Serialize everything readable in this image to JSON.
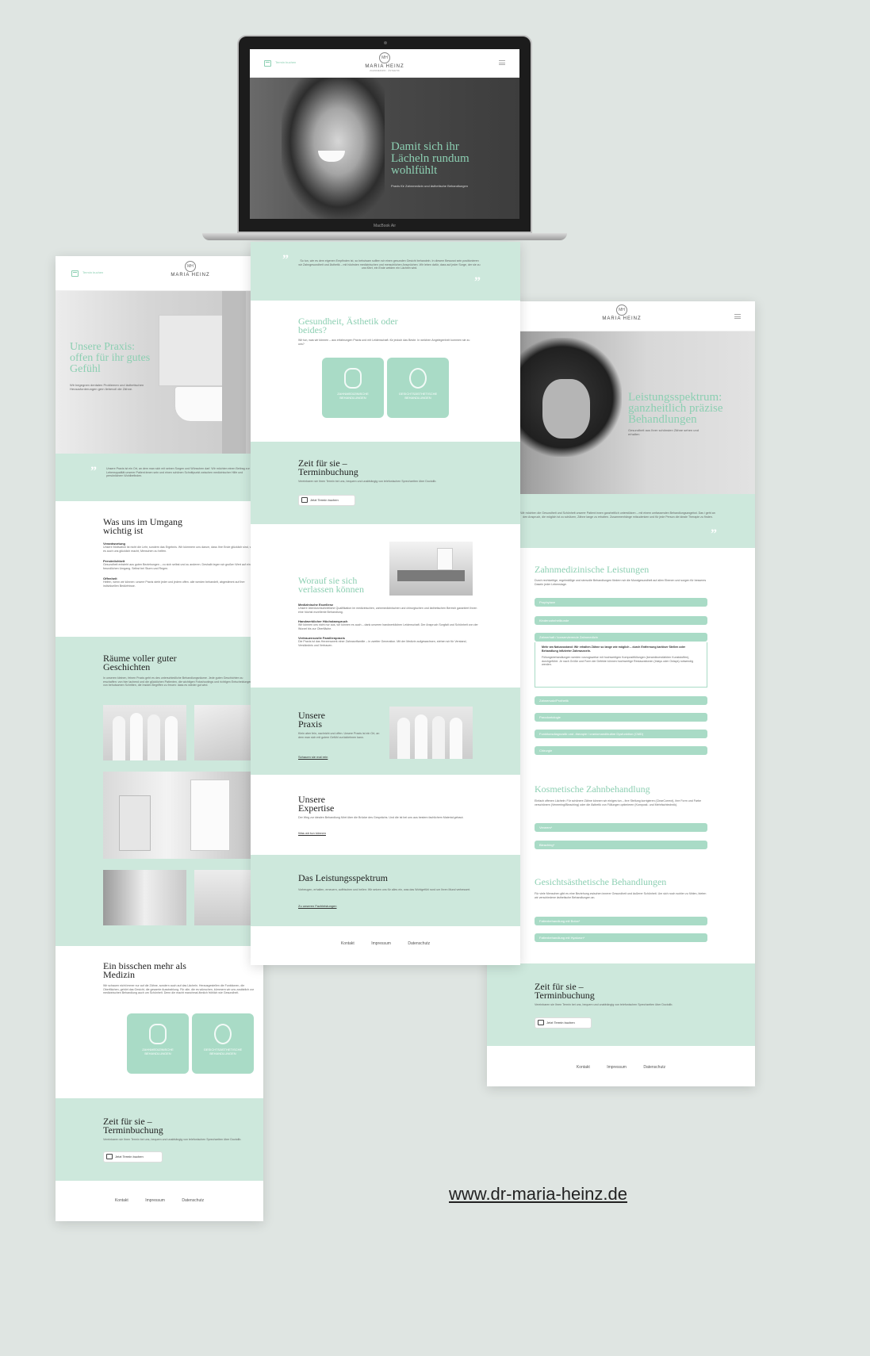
{
  "brand": {
    "name": "MARIA HEINZ",
    "monogram": "MH",
    "tagline": "ZAHNMEDIZIN · ÄSTHETIK",
    "booking_link": "Termin buchen",
    "accent_color": "#8ccfb2",
    "mint_color": "#cde8dc"
  },
  "laptop": {
    "label": "MacBook Air",
    "hero_title": "Damit sich ihr Lächeln rundum wohlfühlt",
    "hero_sub": "Praxis für Zahnmedizin und ästhetische Behandlungen"
  },
  "center_page": {
    "quote": "So tun, wie es dem eigenen Empfinden ist, so behutsam sollten wir einen gesunden Gesicht behandeln. In diesem Bewusst sein positionieren wir Zahngesundheit und Ästhetik – mit höchsten medizinischen und menschlichen Ansprüchen. Wir leben dafür, dass auf jeder Sorge, der sie zu uns führt, ein Ende weiden ein Lächeln wird.",
    "s1_title": "Gesundheit, Ästhetik oder beides?",
    "s1_text": "Wir tun, was wir können – aus erfahrungen Praxis und mit Leidenschaft. für jedoch das Beste. In welchen Angelegenheit kommen sie zu uns?",
    "tile1": "ZAHNMEDIZINISCHE BEHANDLUNGEN",
    "tile2": "GESICHTSÄSTHETISCHE BEHANDLUNGEN",
    "booking_title": "Zeit für sie – Terminbuchung",
    "booking_text": "Vereinbaren sie Ihren Termin bei uns, bequem und unabhängig von telefonischen Sprechzeiten über Doctolib.",
    "booking_btn": "Jetzt Termin buchen",
    "rely_title": "Worauf sie sich verlassen können",
    "rely_items": [
      {
        "h": "Medizinische Exzellenz",
        "t": "Unsere überdurchschnittliche Qualifikation im medizinischen, zahnmedizinischen und chirurgischen und ästhetischen Bereich garantiert Ihnen eine höchst exzellente Behandlung."
      },
      {
        "h": "Handwerklicher Höchstanspruch",
        "t": "Wir können uns nicht nur aus, wir können es auch – dank unseren handwerklichen Leidenschaft. Der Anspruch Sorgfalt und Schönheit von der Wurzel bis zur Oberfläche."
      },
      {
        "h": "Vertrauensvolle Familienpraxis",
        "t": "Die Praxis ist das Herzenswerk einer Zahnarztfamilie – in zweiter Generation. Mit der Medizin aufgewachsen, stehen wir für Verstand, Verständnis und Vertrauen."
      }
    ],
    "praxis_title": "Unsere Praxis",
    "praxis_text": "Klein aber fein, nachricht und offen. Unsere Praxis ist ein Ort, an dem man sich mit gutem Gefühl zurücklehnen kann.",
    "praxis_link": "Schauen sie mal rein",
    "expertise_title": "Unsere Expertise",
    "expertise_text": "Der Weg zur idealen Behandlung führt über die Brücke des Gesprächs. Und die ist bei uns aus bestem fachlichem Material gebaut.",
    "expertise_link": "Was wir tun können",
    "leist_title": "Das Leistungsspektrum",
    "leist_text": "Vorbeugen, erhalten, erneuern, auffrischen und heilen: Wir setzen uns für alles ein, was das Wohlgefühl rund um Ihren Mund verbessert.",
    "leist_link": "Zu unseren Fachleistungen"
  },
  "left_page": {
    "hero_title": "Unsere Praxis: offen für ihr gutes Gefühl",
    "hero_sub": "Wir begegnen dentalen Problemen und ästhetischen Herausforderungen gern liebevoll die Zähne.",
    "quote": "Unsere Praxis ist ein Ort, an dem man sich mit seinen Sorgen und Wünschen darf. Wir möchten einen Beitrag zur Lebensqualität unserer Patient:innen sein und einen schönen Schnittpunkt zwischen medizinischer Hilfe und persönlichem Wohlbefinden.",
    "values_title": "Was uns im Umgang wichtig ist",
    "values": [
      {
        "h": "Verantwortung",
        "t": "Unsere Motivation ist nicht die Lehr, sondern das Ergebnis. Wir kümmern uns darum, dass Ihre Ende glücklich sind, weil es auch uns glücklich macht, Menschen zu helfen."
      },
      {
        "h": "Persönlichkeit",
        "t": "Gesundheit entsteht aus guten Beziehungen – zu sich selbst und zu anderen. Deshalb legen wir großen Wert auf einen freundlichen Umgang. Selbst bei Sturm und Regen."
      },
      {
        "h": "Offenheit",
        "t": "Helfen, wenn wir können: unsere Praxis steht jeder und jedem offen. alle werden behandelt, abgestimmt auf ihre individuellen Bedürfnisse."
      }
    ],
    "rooms_title": "Räume voller guter Geschichten",
    "rooms_text": "In unseren kleinen, feinen Praxis geht es des unterschiedliche Behandlungsräume. Jede guten Geschichten zu erschaffen: von hier lachend und die glücklichen Patienten, die wichtigen Fotoshootings und richtigen Entscheidungen, von behutsamen Schritten, die Insider-Begriffen zu freuen: dass es wieder gut wird.",
    "more_title": "Ein bisschen mehr als Medizin",
    "more_text": "Wir schauen nicht immer nur auf die Zähne, sondern auch auf das Lächeln. Herausgestellen die Funktionen, die Oberflächen, gehört das Gesicht, die gesamte Ausstrahlung. Für alle, die es wünschen, kümmern wir uns zusätzlich zur medizinischen Behandlung auch um Schönheit. Denn die macht manchmal ähnlich fröhlich wie Gesundheit.",
    "tile1": "ZAHNMEDIZINISCHE BEHANDLUNGEN",
    "tile2": "GESICHTSÄSTHETISCHE BEHANDLUNGEN",
    "booking_title": "Zeit für sie – Terminbuchung",
    "booking_text": "Vereinbaren sie Ihren Termin bei uns, bequem und unabhängig von telefonischen Sprechzeiten über Doctolib.",
    "booking_btn": "Jetzt Termin buchen"
  },
  "right_page": {
    "hero_title": "Leistungsspektrum: ganzheitlich präzise Behandlungen",
    "hero_sub": "Gesundheit aus Ihrer schönsten Zähne sehen und erhalten",
    "quote": "Wir möchten die Gesundheit und Schönheit unserer Patient:innen ganzheitlich unterstützen – mit einem umfassenden Behandlungsangebot. Das i geht an den Anspruch, die möglich ist zu schützen, Zähne lange zu erhalten. Zusammenhänge mitzudenken und für jede Person die ideale Therapie zu finden.",
    "zm_title": "Zahnmedizinische Leistungen",
    "zm_text": "Durch rechtzeitige, regelmäßige und sinnvolle Behandlungen fördern wir die Mundgesundheit auf allen Ebenen und sorgen für besseres Dasein jeder Lebenslage.",
    "zm_items": [
      "Prophylaxe",
      "Kinderzahnheilkunde",
      "Zahnerhalt / konservierende Zahnmedizin",
      "Zahnersatz/Prothetik",
      "Parodontologie",
      "Funktionsdiagnostik und -therapie / craniomandibuläre Dysfunktion (CMD)",
      "Chirurgie"
    ],
    "zm_open_head": "Mehr am Naturzustand: Wir erhalten Zähne so lange wie möglich – durch Entfernung kariöser Stellen oder Behandlung infizierter Zahnwurzeln.",
    "zm_open_text": "Füllungsbehandlungen werden vorzugsweise mit hochwertigen Kompositfüllungen (keramikverstärkten Kunststoffen), durchgeführt. Je nach Größe und Form der Defekte können hochwertige Restaurationen (Inlays oder Onlays) notwendig werden.",
    "kz_title": "Kosmetische Zahnbehandlung",
    "kz_text": "Einfach offenen Lächeln: Für schönere Zähne können wir einiges tun – ihre Stellung korrigieren (ClearCorrect), ihre Form und Farbe verschönern (Veneering/Bleaching) oder die Ästhetik von Füllungen optimieren (Komposit- und Mehrfachtechnik).",
    "kz_items": [
      "Veneers*",
      "Bleaching*"
    ],
    "ga_title": "Gesichtsästhetische Behandlungen",
    "ga_text": "Für viele Menschen gibt es eine Beziehung zwischen innerer Gesundheit und äußerer Schönheit. Um sich noch wohler zu fühlen, bieten wir verschiedene ästhetische Behandlungen an.",
    "ga_items": [
      "Faltenbehandlung mit Botox*",
      "Faltenbehandlung mit Hyaluron*"
    ],
    "booking_title": "Zeit für sie – Terminbuchung",
    "booking_text": "Vereinbaren sie Ihren Termin bei uns, bequem und unabhängig von telefonischen Sprechzeiten über Doctolib.",
    "booking_btn": "Jetzt Termin buchen"
  },
  "footer": {
    "kontakt": "Kontakt",
    "impressum": "Impressum",
    "datenschutz": "Datenschutz"
  },
  "website_url": "www.dr-maria-heinz.de"
}
